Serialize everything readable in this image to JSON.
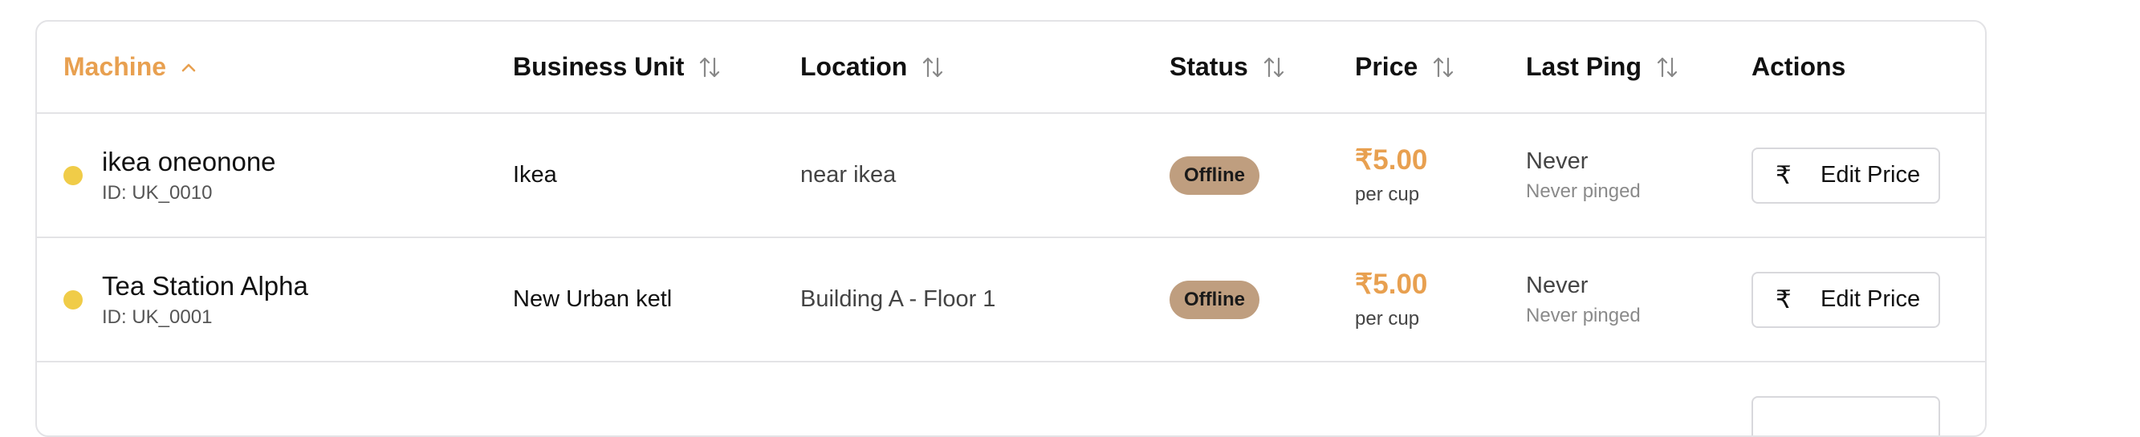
{
  "table": {
    "columns": {
      "machine": "Machine",
      "business_unit": "Business Unit",
      "location": "Location",
      "status": "Status",
      "price": "Price",
      "last_ping": "Last Ping",
      "actions": "Actions"
    },
    "sort": {
      "column": "machine",
      "direction": "ascending"
    },
    "rows": [
      {
        "name": "ikea oneonone",
        "id": "ID: UK_0010",
        "business_unit": "Ikea",
        "location": "near ikea",
        "status": "Offline",
        "price": "₹5.00",
        "price_unit": "per cup",
        "last_ping": "Never",
        "last_ping_detail": "Never pinged",
        "action_icon": "₹",
        "action_label": "Edit Price"
      },
      {
        "name": "Tea Station Alpha",
        "id": "ID: UK_0001",
        "business_unit": "New Urban ketl",
        "location": "Building A - Floor 1",
        "status": "Offline",
        "price": "₹5.00",
        "price_unit": "per cup",
        "last_ping": "Never",
        "last_ping_detail": "Never pinged",
        "action_icon": "₹",
        "action_label": "Edit Price"
      }
    ]
  },
  "colors": {
    "accent": "#e8a050",
    "status_dot": "#f0cc48",
    "offline_badge": "#bf9e7f",
    "border": "#e3e3e6"
  },
  "icons": {
    "sort_asc": "chevron-up-icon",
    "sortable": "sort-arrows-icon",
    "status_dot": "status-dot",
    "action": "rupee-icon"
  }
}
